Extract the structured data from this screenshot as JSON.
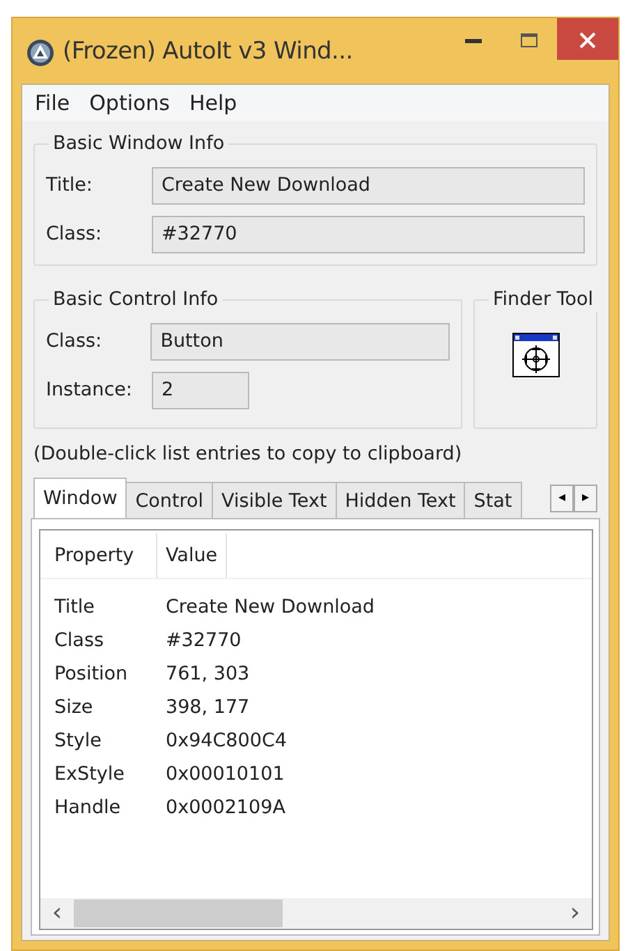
{
  "window": {
    "title": "(Frozen) AutoIt v3 Wind..."
  },
  "menu": [
    "File",
    "Options",
    "Help"
  ],
  "basic_window_info": {
    "legend": "Basic Window Info",
    "fields": [
      {
        "label": "Title:",
        "value": "Create New Download"
      },
      {
        "label": "Class:",
        "value": "#32770"
      }
    ]
  },
  "basic_control_info": {
    "legend": "Basic Control Info",
    "fields": [
      {
        "label": "Class:",
        "value": "Button",
        "kind": "wide"
      },
      {
        "label": "Instance:",
        "value": "2",
        "kind": "narrow"
      }
    ]
  },
  "finder_tool": {
    "legend": "Finder Tool"
  },
  "hint": "(Double-click list entries to copy to clipboard)",
  "tabs": [
    {
      "label": "Window",
      "selected": true
    },
    {
      "label": "Control",
      "selected": false
    },
    {
      "label": "Visible Text",
      "selected": false
    },
    {
      "label": "Hidden Text",
      "selected": false
    },
    {
      "label": "Stat",
      "selected": false
    }
  ],
  "tab_scroll": [
    "◂",
    "▸"
  ],
  "table": {
    "columns": [
      "Property",
      "Value"
    ],
    "rows": [
      [
        "Title",
        "Create New Download"
      ],
      [
        "Class",
        "#32770"
      ],
      [
        "Position",
        "761, 303"
      ],
      [
        "Size",
        "398, 177"
      ],
      [
        "Style",
        "0x94C800C4"
      ],
      [
        "ExStyle",
        "0x00010101"
      ],
      [
        "Handle",
        "0x0002109A"
      ]
    ]
  },
  "scrollbar": [
    "‹",
    "›"
  ]
}
